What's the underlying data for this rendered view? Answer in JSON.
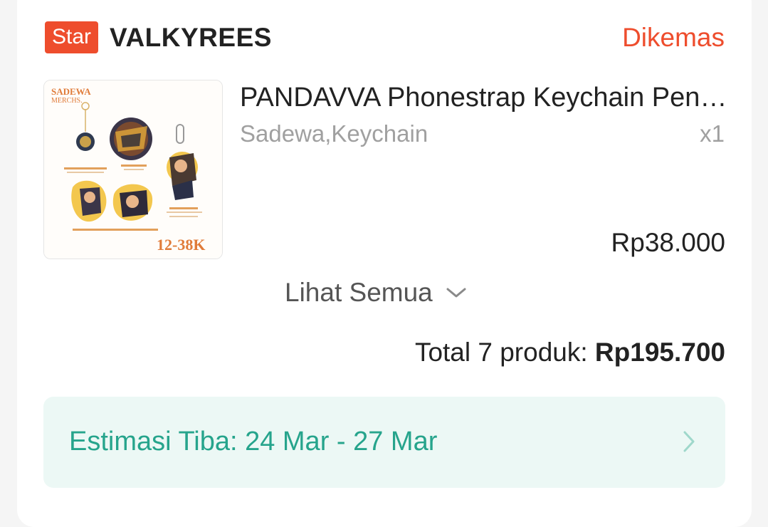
{
  "shop": {
    "badge": "Star",
    "name": "VALKYREES"
  },
  "order": {
    "status": "Dikemas"
  },
  "product": {
    "name": "PANDAVVA Phonestrap Keychain Pendant Acrylic",
    "variant": "Sadewa,Keychain",
    "quantity": "x1",
    "price": "Rp38.000",
    "thumbnail": {
      "title": "SADEWA",
      "subtitle": "MERCHS.",
      "price_range": "12-38K"
    }
  },
  "see_all": {
    "label": "Lihat Semua"
  },
  "total": {
    "label": "Total 7 produk: ",
    "amount": "Rp195.700"
  },
  "delivery": {
    "eta": "Estimasi Tiba: 24 Mar - 27 Mar"
  },
  "colors": {
    "accent": "#ee4d2d",
    "eta_text": "#26a48c",
    "eta_bg": "#ecf8f5"
  }
}
